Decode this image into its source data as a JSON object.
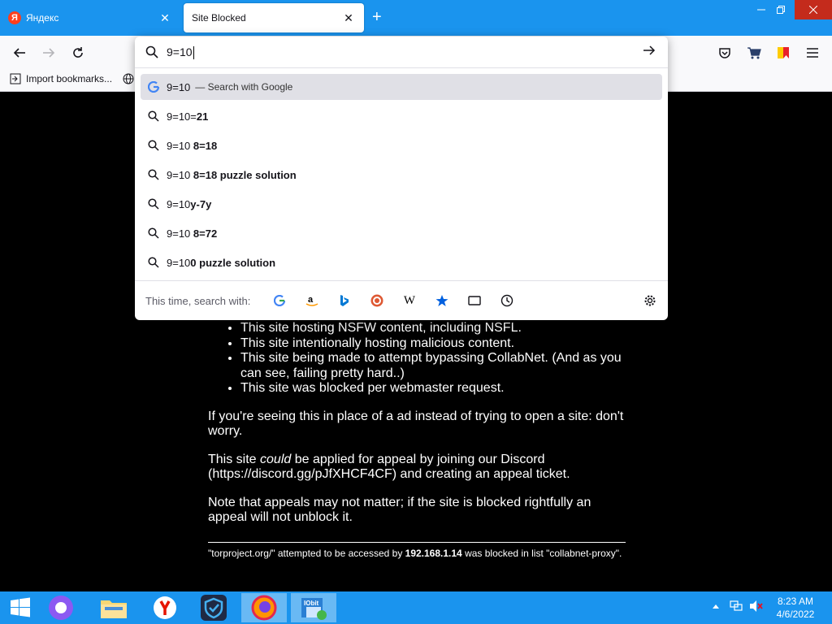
{
  "tabs": [
    {
      "label": "Яндекс",
      "favicon_letter": "Я",
      "active": false
    },
    {
      "label": "Site Blocked",
      "active": true
    }
  ],
  "bookmarks": {
    "import_label": "Import bookmarks..."
  },
  "urlbar": {
    "value": "9=10",
    "suggestions": [
      {
        "prefix": "9=10",
        "bold": "",
        "sub": "— Search with Google",
        "icon": "google-icon",
        "selected": true
      },
      {
        "prefix": "9=10=",
        "bold": "21",
        "sub": "",
        "icon": "search-icon"
      },
      {
        "prefix": "9=10 ",
        "bold": "8=18",
        "sub": "",
        "icon": "search-icon"
      },
      {
        "prefix": "9=10 ",
        "bold": "8=18 puzzle solution",
        "sub": "",
        "icon": "search-icon"
      },
      {
        "prefix": "9=10",
        "bold": "y-7y",
        "sub": "",
        "icon": "search-icon"
      },
      {
        "prefix": "9=10 ",
        "bold": "8=72",
        "sub": "",
        "icon": "search-icon"
      },
      {
        "prefix": "9=10",
        "bold": "0 puzzle solution",
        "sub": "",
        "icon": "search-icon"
      }
    ],
    "oneoff_label": "This time, search with:",
    "engines": [
      "google-icon",
      "amazon-icon",
      "bing-icon",
      "duckduckgo-icon",
      "wikipedia-icon",
      "bookmarks-star-icon",
      "tabs-icon",
      "history-icon"
    ],
    "wikipedia_glyph": "W"
  },
  "page": {
    "bullets": [
      "This site hosting NSFW content, including NSFL.",
      "This site intentionally hosting malicious content.",
      "This site being made to attempt bypassing CollabNet. (And as you can see, failing pretty hard..)",
      "This site was blocked per webmaster request."
    ],
    "para1": "If you're seeing this in place of a ad instead of trying to open a site: don't worry.",
    "para2_a": "This site ",
    "para2_em": "could",
    "para2_b": " be applied for appeal by joining our Discord (https://discord.gg/pJfXHCF4CF) and creating an appeal ticket.",
    "para3": "Note that appeals may not matter; if the site is blocked rightfully an appeal will not unblock it.",
    "footer_a": "\"torproject.org/\" attempted to be accessed by ",
    "footer_ip": "192.168.1.14",
    "footer_b": " was blocked in list \"collabnet-proxy\"."
  },
  "taskbar": {
    "time": "8:23 AM",
    "date": "4/6/2022",
    "iobit_label": "IObit"
  },
  "colors": {
    "taskbar": "#1a94ee",
    "tabstrip": "#1a94ee",
    "close_red": "#c42b1c"
  }
}
